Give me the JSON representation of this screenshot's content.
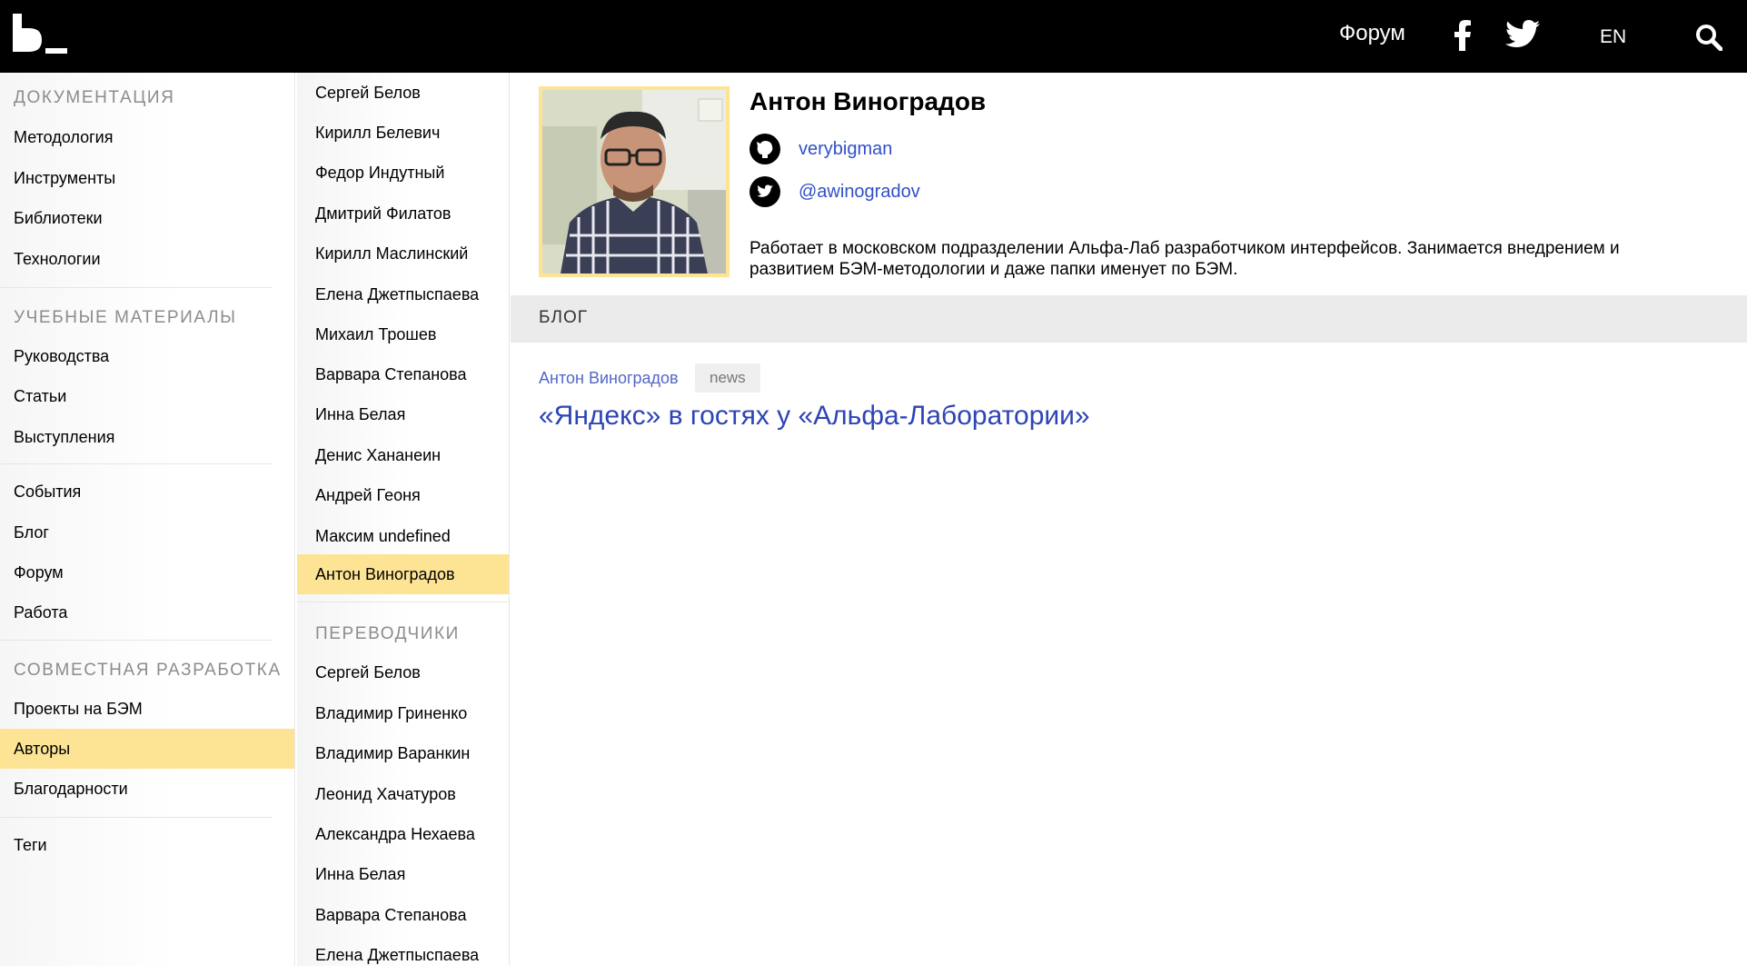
{
  "header": {
    "forum_label": "Форум",
    "lang_label": "EN"
  },
  "leftnav": {
    "sections": {
      "docs": {
        "title": "Документация",
        "items": [
          "Методология",
          "Инструменты",
          "Библиотеки",
          "Технологии"
        ]
      },
      "learning": {
        "title": "Учебные материалы",
        "items": [
          "Руководства",
          "Статьи",
          "Выступления"
        ]
      },
      "community": {
        "items": [
          "События",
          "Блог",
          "Форум",
          "Работа"
        ]
      },
      "collab": {
        "title": "Совместная разработка",
        "items": [
          "Проекты на БЭМ",
          "Авторы",
          "Благодарности"
        ]
      },
      "tags": {
        "items": [
          "Теги"
        ]
      }
    }
  },
  "authors": {
    "list": [
      "Сергей Белов",
      "Кирилл Белевич",
      "Федор Индутный",
      "Дмитрий Филатов",
      "Кирилл Маслинский",
      "Елена Джетпыспаева",
      "Михаил Трошев",
      "Варвара Степанова",
      "Инна Белая",
      "Денис Хананеин",
      "Андрей Геоня",
      "Максим undefined",
      "Антон Виноградов"
    ],
    "translators_title": "Переводчики",
    "translators": [
      "Сергей Белов",
      "Владимир Гриненко",
      "Владимир Варанкин",
      "Леонид Хачатуров",
      "Александра Нехаева",
      "Инна Белая",
      "Варвара Степанова",
      "Елена Джетпыспаева"
    ]
  },
  "profile": {
    "name": "Антон Виноградов",
    "github": "verybigman",
    "twitter": "@awinogradov",
    "bio": "Работает в московском подразделении Альфа-Лаб разработчиком интерфейсов. Занимается внедрением и развитием БЭМ-методологии и даже папки именует по БЭМ."
  },
  "blog": {
    "title": "БЛОГ",
    "post_author": "Антон Виноградов",
    "post_tag": "news",
    "post_title": "«Яндекс» в гостях у «Альфа-Лаборатории»"
  },
  "colors": {
    "active": "#fde495",
    "link": "#3050c8"
  }
}
